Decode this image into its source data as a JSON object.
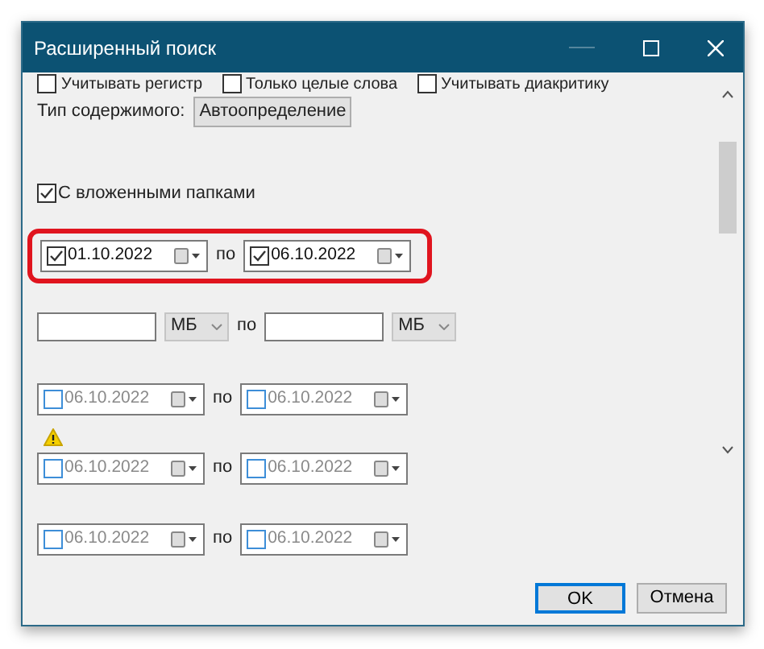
{
  "window": {
    "title": "Расширенный поиск"
  },
  "options": [
    {
      "label": "Учитывать регистр",
      "checked": false
    },
    {
      "label": "Только целые слова",
      "checked": false
    },
    {
      "label": "Учитывать диакритику",
      "checked": false
    }
  ],
  "content_type": {
    "label": "Тип содержимого:",
    "value": "Автоопределение"
  },
  "subfolders": {
    "label": "С вложенными папками",
    "checked": true
  },
  "filters": [
    {
      "kind": "date",
      "highlighted": true,
      "warning": false,
      "from": {
        "value": "01.10.2022",
        "checked": true
      },
      "separator": "по",
      "to": {
        "value": "06.10.2022",
        "checked": true
      }
    },
    {
      "kind": "size",
      "highlighted": false,
      "warning": false,
      "from": {
        "unit": "МБ"
      },
      "separator": "по",
      "to": {
        "unit": "МБ"
      }
    },
    {
      "kind": "date",
      "highlighted": false,
      "warning": false,
      "from": {
        "value": "06.10.2022",
        "checked": false
      },
      "separator": "по",
      "to": {
        "value": "06.10.2022",
        "checked": false
      }
    },
    {
      "kind": "date",
      "highlighted": false,
      "warning": true,
      "from": {
        "value": "06.10.2022",
        "checked": false
      },
      "separator": "по",
      "to": {
        "value": "06.10.2022",
        "checked": false
      }
    },
    {
      "kind": "date",
      "highlighted": false,
      "warning": false,
      "from": {
        "value": "06.10.2022",
        "checked": false
      },
      "separator": "по",
      "to": {
        "value": "06.10.2022",
        "checked": false
      }
    }
  ],
  "buttons": [
    {
      "label": "OK",
      "default": true
    },
    {
      "label": "Отмена",
      "default": false
    }
  ]
}
